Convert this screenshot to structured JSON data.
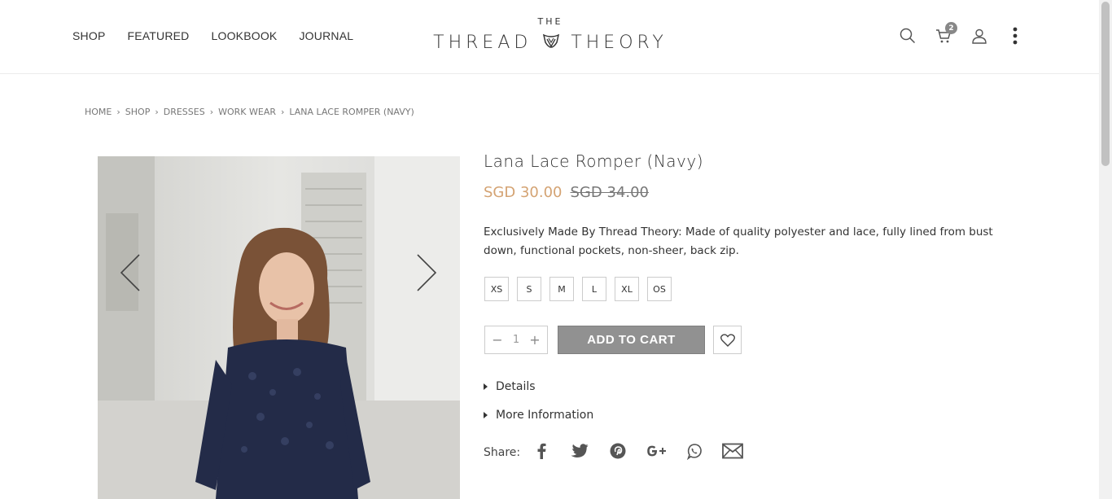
{
  "header": {
    "nav": [
      "SHOP",
      "FEATURED",
      "LOOKBOOK",
      "JOURNAL"
    ],
    "logo_small": "THE",
    "logo_left": "THREAD",
    "logo_right": "THEORY",
    "cart_count": "2",
    "icons": [
      "search-icon",
      "cart-icon",
      "user-icon",
      "more-vertical-icon"
    ]
  },
  "breadcrumb": [
    "HOME",
    "SHOP",
    "DRESSES",
    "WORK WEAR",
    "LANA LACE ROMPER (NAVY)"
  ],
  "product": {
    "title": "Lana Lace Romper (Navy)",
    "price_now": "SGD 30.00",
    "price_old": "SGD 34.00",
    "description": "Exclusively Made By Thread Theory: Made of quality polyester and lace, fully lined from bust down, functional pockets, non-sheer, back zip.",
    "sizes": [
      "XS",
      "S",
      "M",
      "L",
      "XL",
      "OS"
    ],
    "quantity": "1",
    "add_to_cart": "ADD TO CART",
    "details_label": "Details",
    "more_info_label": "More Information",
    "share_label": "Share:",
    "share_icons": [
      "facebook-icon",
      "twitter-icon",
      "pinterest-icon",
      "google-plus-icon",
      "whatsapp-icon",
      "email-icon"
    ]
  },
  "colors": {
    "price_accent": "#d4a373",
    "button_bg": "#919191",
    "text": "#333333"
  }
}
